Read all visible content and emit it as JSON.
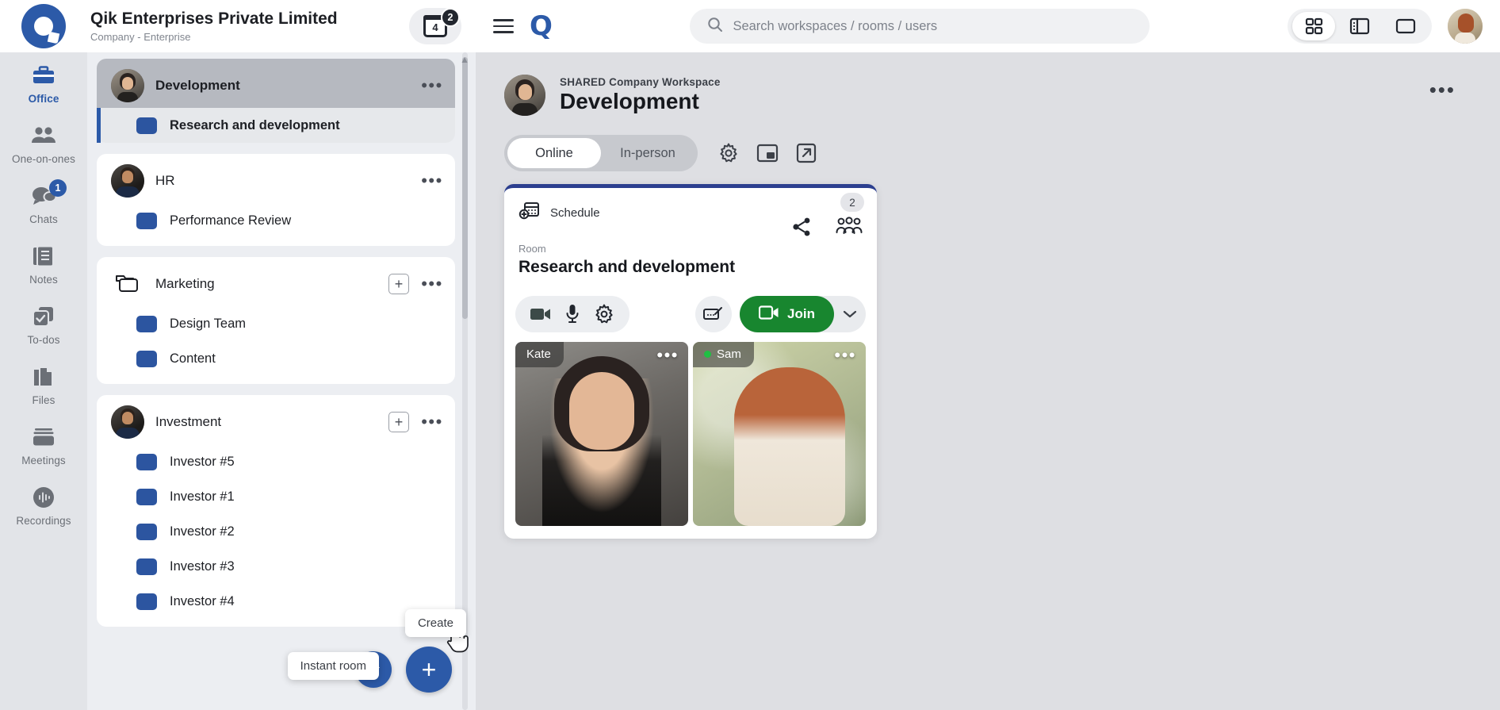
{
  "company": {
    "name": "Qik Enterprises Private Limited",
    "subtitle": "Company - Enterprise",
    "logo_icon": "qik-logo-icon",
    "calendar_day": "4",
    "calendar_badge": "2"
  },
  "rail": {
    "items": [
      {
        "label": "Office",
        "icon": "briefcase-icon",
        "active": true,
        "badge": ""
      },
      {
        "label": "One-on-ones",
        "icon": "people-icon",
        "active": false,
        "badge": ""
      },
      {
        "label": "Chats",
        "icon": "chat-bubble-icon",
        "active": false,
        "badge": "1"
      },
      {
        "label": "Notes",
        "icon": "notes-icon",
        "active": false,
        "badge": ""
      },
      {
        "label": "To-dos",
        "icon": "checkbox-icon",
        "active": false,
        "badge": ""
      },
      {
        "label": "Files",
        "icon": "files-icon",
        "active": false,
        "badge": ""
      },
      {
        "label": "Meetings",
        "icon": "meetings-icon",
        "active": false,
        "badge": ""
      },
      {
        "label": "Recordings",
        "icon": "recordings-icon",
        "active": false,
        "badge": ""
      }
    ]
  },
  "workspaces": {
    "groups": [
      {
        "name": "Development",
        "icon": "avatar-woman",
        "selected": true,
        "has_add": false,
        "rooms": [
          {
            "name": "Research and development",
            "active": true
          }
        ]
      },
      {
        "name": "HR",
        "icon": "avatar-man",
        "selected": false,
        "has_add": false,
        "rooms": [
          {
            "name": "Performance Review",
            "active": false
          }
        ]
      },
      {
        "name": "Marketing",
        "icon": "folder-stack-icon",
        "selected": false,
        "has_add": true,
        "rooms": [
          {
            "name": "Design Team",
            "active": false
          },
          {
            "name": "Content",
            "active": false
          }
        ]
      },
      {
        "name": "Investment",
        "icon": "avatar-man",
        "selected": false,
        "has_add": true,
        "rooms": [
          {
            "name": "Investor #5",
            "active": false
          },
          {
            "name": "Investor #1",
            "active": false
          },
          {
            "name": "Investor #2",
            "active": false
          },
          {
            "name": "Investor #3",
            "active": false
          },
          {
            "name": "Investor #4",
            "active": false
          }
        ]
      }
    ],
    "more_menu_label": "•••",
    "add_label": "+",
    "fab_instant_label": "Instant room",
    "fab_create_label": "Create"
  },
  "topbar": {
    "menu_icon": "hamburger-icon",
    "logo_text": "Q",
    "search": {
      "placeholder": "Search workspaces / rooms / users",
      "value": "",
      "icon": "search-icon"
    },
    "layouts": [
      {
        "icon": "grid-layout-icon",
        "active": true
      },
      {
        "icon": "split-layout-icon",
        "active": false
      },
      {
        "icon": "single-layout-icon",
        "active": false
      }
    ]
  },
  "main": {
    "hero": {
      "kicker": "SHARED Company Workspace",
      "title": "Development",
      "more_label": "•••"
    },
    "tabs": [
      {
        "label": "Online",
        "active": true
      },
      {
        "label": "In-person",
        "active": false
      }
    ],
    "tab_icons": [
      {
        "icon": "gear-icon"
      },
      {
        "icon": "picture-in-picture-icon"
      },
      {
        "icon": "expand-external-icon"
      }
    ],
    "room_card": {
      "schedule_label": "Schedule",
      "schedule_icon": "calendar-add-icon",
      "participant_count": "2",
      "share_icon": "share-icon",
      "people_icon": "people-group-icon",
      "room_kicker": "Room",
      "room_title": "Research and development",
      "controls": [
        {
          "icon": "camera-icon"
        },
        {
          "icon": "microphone-icon"
        },
        {
          "icon": "settings-gear-icon"
        }
      ],
      "whiteboard_icon": "whiteboard-icon",
      "join_label": "Join",
      "join_icon": "video-camera-icon",
      "join_caret_icon": "chevron-down-icon",
      "join_color": "#18862f",
      "participants": [
        {
          "name": "Kate",
          "online": false,
          "more_label": "•••"
        },
        {
          "name": "Sam",
          "online": true,
          "more_label": "•••"
        }
      ]
    }
  },
  "colors": {
    "brand_blue": "#2c5aa8",
    "room_chip": "#2c55a0",
    "join_green": "#18862f",
    "online_dot": "#1fc043",
    "card_accent": "#2c3f8f"
  }
}
